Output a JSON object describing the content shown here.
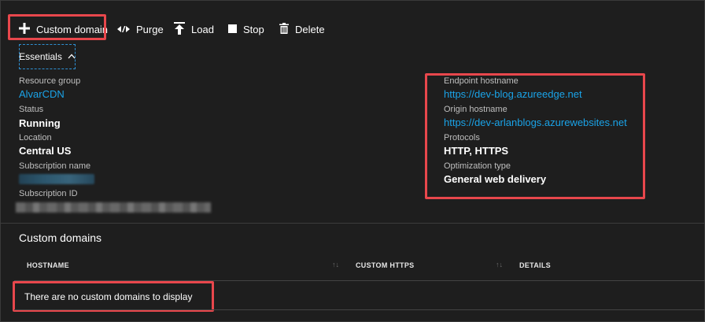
{
  "toolbar": {
    "custom_domain": "Custom domain",
    "purge": "Purge",
    "load": "Load",
    "stop": "Stop",
    "delete": "Delete"
  },
  "essentials": {
    "tab_label": "Essentials",
    "left": {
      "resource_group_label": "Resource group",
      "resource_group_value": "AlvarCDN",
      "status_label": "Status",
      "status_value": "Running",
      "location_label": "Location",
      "location_value": "Central US",
      "subscription_name_label": "Subscription name",
      "subscription_id_label": "Subscription ID"
    },
    "right": {
      "endpoint_hostname_label": "Endpoint hostname",
      "endpoint_hostname_value": "https://dev-blog.azureedge.net",
      "origin_hostname_label": "Origin hostname",
      "origin_hostname_value": "https://dev-arlanblogs.azurewebsites.net",
      "protocols_label": "Protocols",
      "protocols_value": "HTTP, HTTPS",
      "optimization_type_label": "Optimization type",
      "optimization_type_value": "General web delivery"
    }
  },
  "custom_domains": {
    "title": "Custom domains",
    "columns": [
      "HOSTNAME",
      "CUSTOM HTTPS",
      "DETAILS"
    ],
    "empty_message": "There are no custom domains to display"
  },
  "colors": {
    "background": "#1e1e1e",
    "link": "#1aa3e8",
    "highlight": "#e8474c"
  }
}
